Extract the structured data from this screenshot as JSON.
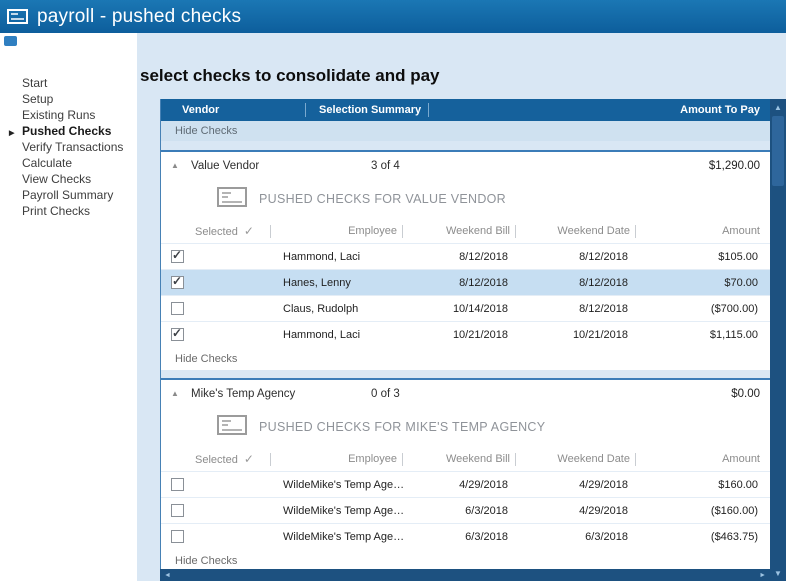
{
  "titlebar": {
    "title": "payroll - pushed checks"
  },
  "sidebar": {
    "items": [
      {
        "label": "Start",
        "active": false
      },
      {
        "label": "Setup",
        "active": false
      },
      {
        "label": "Existing Runs",
        "active": false
      },
      {
        "label": "Pushed Checks",
        "active": true
      },
      {
        "label": "Verify Transactions",
        "active": false
      },
      {
        "label": "Calculate",
        "active": false
      },
      {
        "label": "View Checks",
        "active": false
      },
      {
        "label": "Payroll Summary",
        "active": false
      },
      {
        "label": "Print Checks",
        "active": false
      }
    ]
  },
  "main": {
    "heading": "select checks to consolidate and pay",
    "grid": {
      "columns": {
        "vendor": "Vendor",
        "selection_summary": "Selection Summary",
        "amount_to_pay": "Amount To Pay"
      },
      "hide_checks": "Hide Checks",
      "sub_columns": {
        "selected": "Selected",
        "employee": "Employee",
        "weekend_bill": "Weekend Bill",
        "weekend_date": "Weekend Date",
        "amount": "Amount"
      },
      "groups": [
        {
          "vendor": "Value Vendor",
          "summary": "3 of 4",
          "amount": "$1,290.00",
          "title": "PUSHED CHECKS FOR VALUE VENDOR",
          "hide_checks": "Hide Checks",
          "rows": [
            {
              "checked": true,
              "highlighted": false,
              "employee": "Hammond, Laci",
              "weekend_bill": "8/12/2018",
              "weekend_date": "8/12/2018",
              "amount": "$105.00"
            },
            {
              "checked": true,
              "highlighted": true,
              "employee": "Hanes, Lenny",
              "weekend_bill": "8/12/2018",
              "weekend_date": "8/12/2018",
              "amount": "$70.00"
            },
            {
              "checked": false,
              "highlighted": false,
              "employee": "Claus, Rudolph",
              "weekend_bill": "10/14/2018",
              "weekend_date": "8/12/2018",
              "amount": "($700.00)"
            },
            {
              "checked": true,
              "highlighted": false,
              "employee": "Hammond, Laci",
              "weekend_bill": "10/21/2018",
              "weekend_date": "10/21/2018",
              "amount": "$1,115.00"
            }
          ]
        },
        {
          "vendor": "Mike's Temp Agency",
          "summary": "0 of 3",
          "amount": "$0.00",
          "title": "PUSHED CHECKS FOR MIKE'S TEMP AGENCY",
          "hide_checks": "Hide Checks",
          "rows": [
            {
              "checked": false,
              "highlighted": false,
              "employee": "WildeMike's Temp Age…",
              "weekend_bill": "4/29/2018",
              "weekend_date": "4/29/2018",
              "amount": "$160.00"
            },
            {
              "checked": false,
              "highlighted": false,
              "employee": "WildeMike's Temp Age…",
              "weekend_bill": "6/3/2018",
              "weekend_date": "4/29/2018",
              "amount": "($160.00)"
            },
            {
              "checked": false,
              "highlighted": false,
              "employee": "WildeMike's Temp Age…",
              "weekend_bill": "6/3/2018",
              "weekend_date": "6/3/2018",
              "amount": "($463.75)"
            }
          ]
        }
      ]
    }
  },
  "icons": {
    "collapse": "▲",
    "check": "✓",
    "up": "▲",
    "down": "▼",
    "left": "◄",
    "right": "►"
  },
  "colors": {
    "titlebar": "#0f66a6",
    "grid_header": "#15619c",
    "selected_row": "#c6def2",
    "band": "#cfe1f0"
  }
}
